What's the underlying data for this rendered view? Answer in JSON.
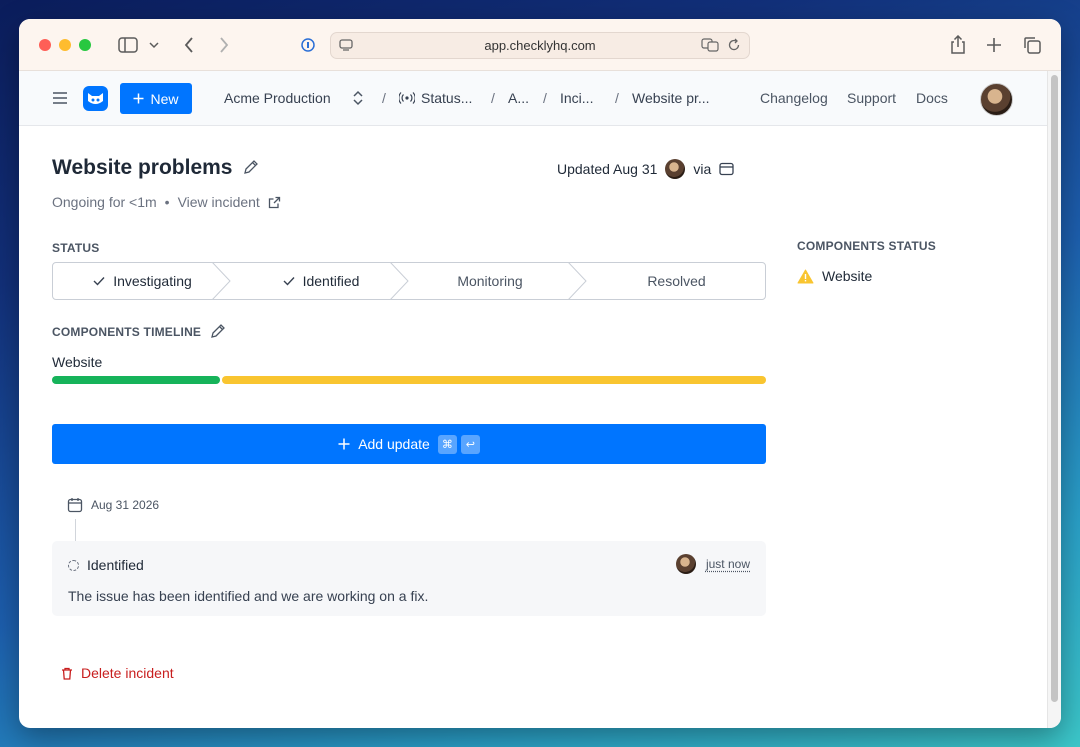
{
  "browser": {
    "url": "app.checklyhq.com"
  },
  "header": {
    "new_button": "New",
    "account": "Acme Production",
    "breadcrumbs": [
      "Status...",
      "A...",
      "Inci...",
      "Website pr..."
    ],
    "separator": "/",
    "links": [
      "Changelog",
      "Support",
      "Docs"
    ]
  },
  "incident": {
    "title": "Website problems",
    "updated_label": "Updated Aug 31",
    "via_label": "via",
    "ongoing": "Ongoing for <1m",
    "bullet": "•",
    "view_incident": "View incident"
  },
  "status": {
    "label": "STATUS",
    "steps": [
      {
        "label": "Investigating",
        "done": true
      },
      {
        "label": "Identified",
        "done": true
      },
      {
        "label": "Monitoring",
        "done": false
      },
      {
        "label": "Resolved",
        "done": false
      }
    ]
  },
  "components_timeline": {
    "label": "COMPONENTS TIMELINE",
    "component": "Website",
    "colors": {
      "operational": "#16b35a",
      "degraded": "#f9c530"
    }
  },
  "add_update": {
    "label": "Add update",
    "shortcut_keys": [
      "⌘",
      "↩"
    ]
  },
  "updates": {
    "date": "Aug 31 2026",
    "items": [
      {
        "status": "Identified",
        "time": "just now",
        "message": "The issue has been identified and we are working on a fix."
      }
    ]
  },
  "delete_label": "Delete incident",
  "components_status": {
    "label": "COMPONENTS STATUS",
    "items": [
      {
        "name": "Website",
        "state": "degraded"
      }
    ]
  },
  "colors": {
    "accent": "#0075ff",
    "danger": "#c81e1e",
    "warning": "#f9c530",
    "success": "#16b35a"
  }
}
